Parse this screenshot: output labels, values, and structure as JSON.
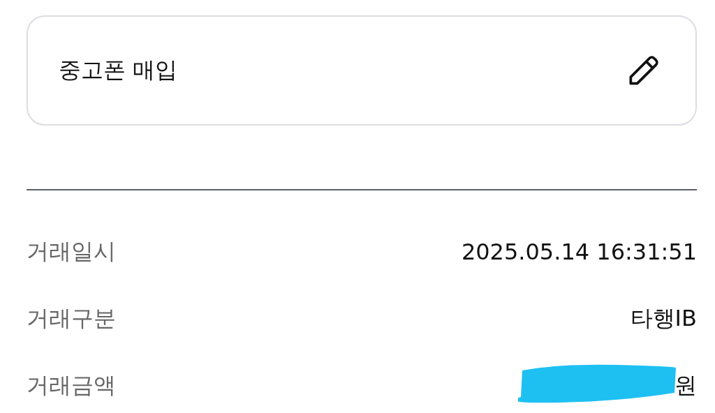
{
  "memo_card": {
    "text": "중고폰 매입"
  },
  "details": [
    {
      "label": "거래일시",
      "value": "2025.05.14 16:31:51",
      "redacted": false
    },
    {
      "label": "거래구분",
      "value": "타행IB",
      "redacted": false
    },
    {
      "label": "거래금액",
      "value": "원",
      "redacted": true
    }
  ]
}
